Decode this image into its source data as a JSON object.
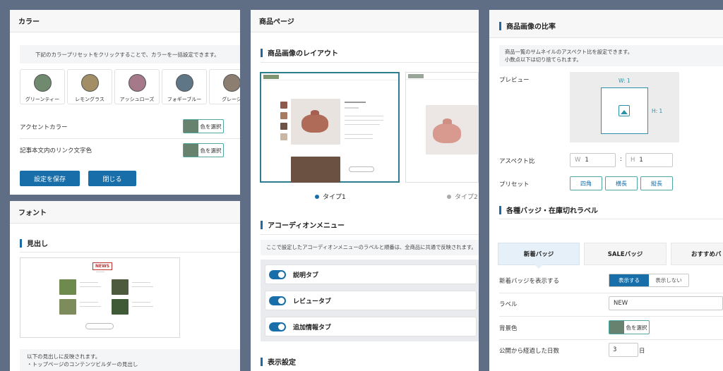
{
  "color_panel": {
    "title": "カラー",
    "description": "下記のカラープリセットをクリックすることで、カラーを一括設定できます。",
    "presets": [
      {
        "name": "グリーンティー",
        "color": "#6f8a6e"
      },
      {
        "name": "レモングラス",
        "color": "#a38d66"
      },
      {
        "name": "アッシュローズ",
        "color": "#a5788a"
      },
      {
        "name": "フォギーブルー",
        "color": "#5f7686"
      },
      {
        "name": "グレージ",
        "color": "#8c7e71"
      }
    ],
    "accent_label": "アクセントカラー",
    "link_label": "記事本文内のリンク文字色",
    "pick_label": "色を選択",
    "save_label": "設定を保存",
    "close_label": "閉じる"
  },
  "font_panel": {
    "title": "フォント",
    "section": "見出し",
    "preview_badge": "NEWS",
    "note_line1": "以下の見出しに反映されます。",
    "note_line2": "・トップページのコンテンツビルダーの見出し"
  },
  "product_panel": {
    "title": "商品ページ",
    "layout_section": "商品画像のレイアウト",
    "type1": "タイプ1",
    "type2": "タイプ2",
    "accordion_section": "アコーディオンメニュー",
    "accordion_note": "ここで設定したアコーディオンメニューのラベルと順番は、全商品に共通で反映されます。",
    "tabs": [
      "説明タブ",
      "レビュータブ",
      "追加情報タブ"
    ],
    "display_section": "表示設定"
  },
  "ratio_panel": {
    "title": "商品画像の比率",
    "note_line1": "商品一覧のサムネイルのアスペクト比を設定できます。",
    "note_line2": "小数点以下は切り捨てられます。",
    "preview_label": "プレビュー",
    "w_label": "W: 1",
    "h_label": "H: 1",
    "aspect_label": "アスペクト比",
    "w_prefix": "W",
    "w_value": "1",
    "colon": ":",
    "h_prefix": "H",
    "h_value": "1",
    "preset_label": "プリセット",
    "preset_buttons": [
      "四角",
      "横長",
      "縦長"
    ],
    "badge_section": "各種バッジ・在庫切れラベル",
    "badge_tabs": [
      "新着バッジ",
      "SALEバッジ",
      "おすすめバ"
    ],
    "show_new_label": "新着バッジを表示する",
    "show_btn": "表示する",
    "hide_btn": "表示しない",
    "label_label": "ラベル",
    "label_value": "NEW",
    "bg_label": "背景色",
    "pick_label": "色を選択",
    "days_label": "公開から経過した日数",
    "days_value": "3",
    "days_unit": "日"
  }
}
